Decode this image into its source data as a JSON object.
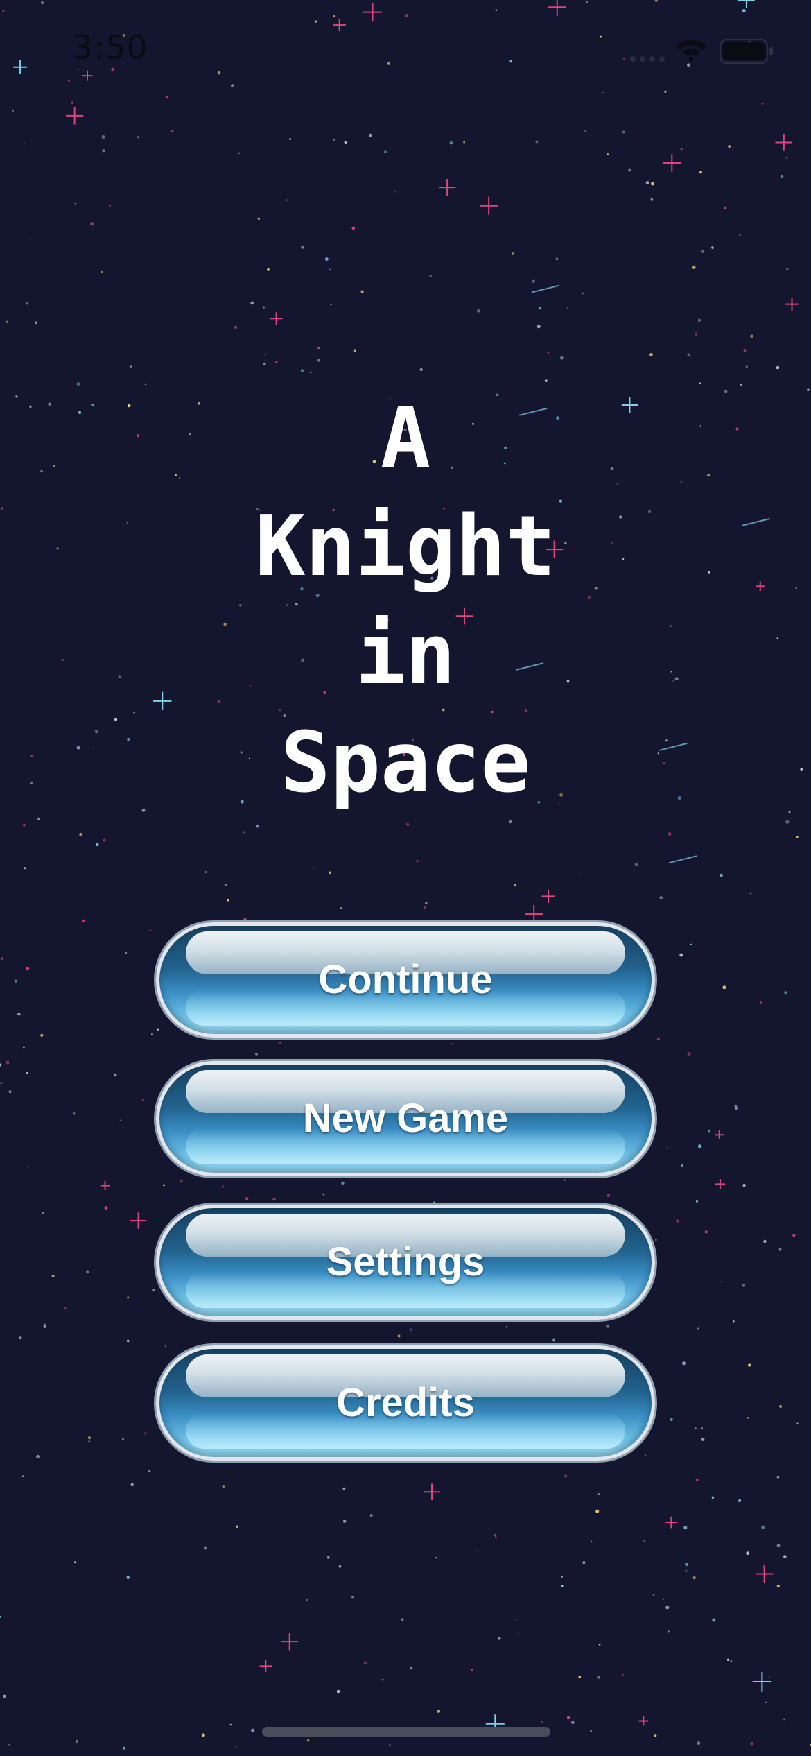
{
  "status_bar": {
    "time": "3:50",
    "icons": [
      "signal-icon",
      "wifi-icon",
      "battery-icon"
    ]
  },
  "title": {
    "lines": [
      "A",
      "Knight",
      "in",
      "Space"
    ]
  },
  "menu": {
    "continue_label": "Continue",
    "new_game_label": "New Game",
    "settings_label": "Settings",
    "credits_label": "Credits"
  },
  "colors": {
    "background": "#141630",
    "star_pink": "#e0447a",
    "star_blue": "#7fd0e6",
    "star_yellow": "#f5d46a",
    "button_top": "#16405f",
    "button_bottom": "#a6e4f7"
  }
}
